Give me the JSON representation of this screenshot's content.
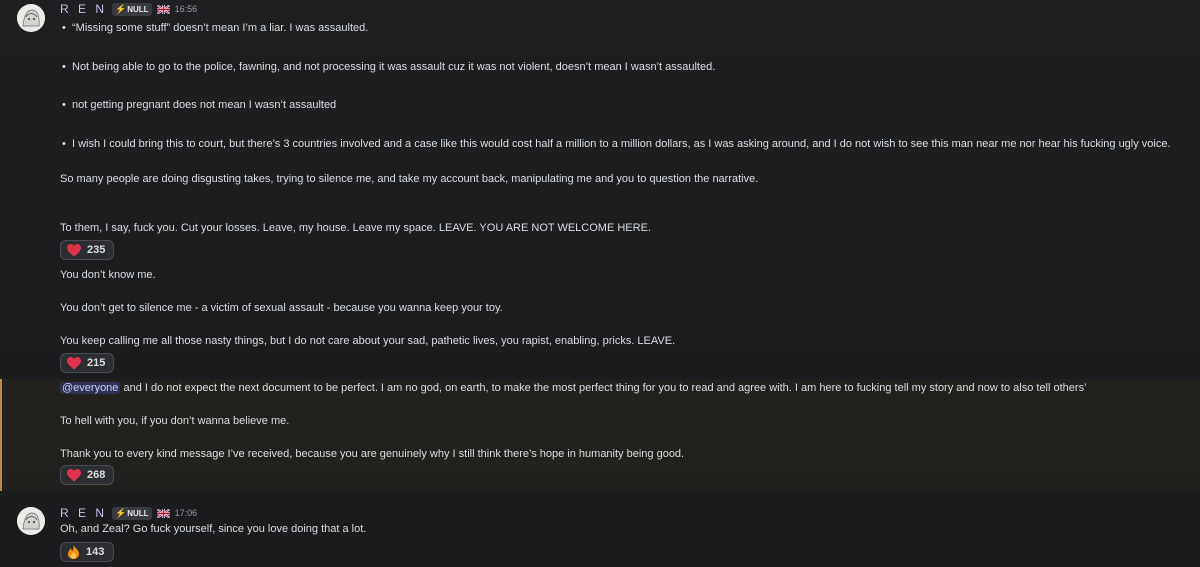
{
  "messages": [
    {
      "author": "R E N",
      "tag": "NULL",
      "time": "16:56",
      "bullets": [
        "“Missing some stuff” doesn’t mean I’m a liar. I was assaulted.",
        "Not being able to go to the police, fawning, and not processing it was assault cuz it was not violent, doesn’t mean I wasn’t assaulted.",
        "not getting pregnant does not mean I wasn’t assaulted",
        "I wish I could bring this to court, but there’s 3 countries involved and a case like this would cost half a million to a million dollars, as I was asking around, and I do not wish to see this man near me nor hear his fucking ugly voice."
      ],
      "lines": [
        "So many people are doing disgusting takes, trying to silence me, and take my account back, manipulating me and you to question the narrative.",
        "To them, I say, fuck you. Cut your losses. Leave, my house. Leave my space. LEAVE. YOU ARE NOT WELCOME HERE."
      ],
      "reaction": {
        "icon": "heart-icon",
        "count": "235"
      }
    },
    {
      "lines": [
        "You don’t know me.",
        "You don’t get to silence me - a victim of sexual assault - because you wanna keep your toy.",
        "You keep calling me all those nasty things, but I do not care about your sad, pathetic lives, you rapist, enabling, pricks. LEAVE."
      ],
      "reaction": {
        "icon": "heart-icon",
        "count": "215"
      }
    },
    {
      "mention": "@everyone",
      "mention_rest": " and I do not expect the next document to be perfect. I am no god, on earth, to make the most perfect thing for you to read and agree with. I am here to fucking tell my story and now to also tell others’",
      "lines": [
        "To hell with you, if you don’t wanna believe me.",
        "Thank you to every kind message I’ve received, because you are genuinely why I still think there’s hope in humanity being good."
      ],
      "reaction": {
        "icon": "heart-icon",
        "count": "268"
      }
    },
    {
      "author": "R E N",
      "tag": "NULL",
      "time": "17:06",
      "lines": [
        "Oh, and Zeal? Go fuck yourself, since you love doing that a lot."
      ],
      "reaction": {
        "icon": "fire-icon",
        "count": "143"
      }
    }
  ],
  "colors": {
    "accent_mention_bar": "#b88e3b",
    "heart": "#e0334a",
    "username": "#c5c0e8"
  }
}
